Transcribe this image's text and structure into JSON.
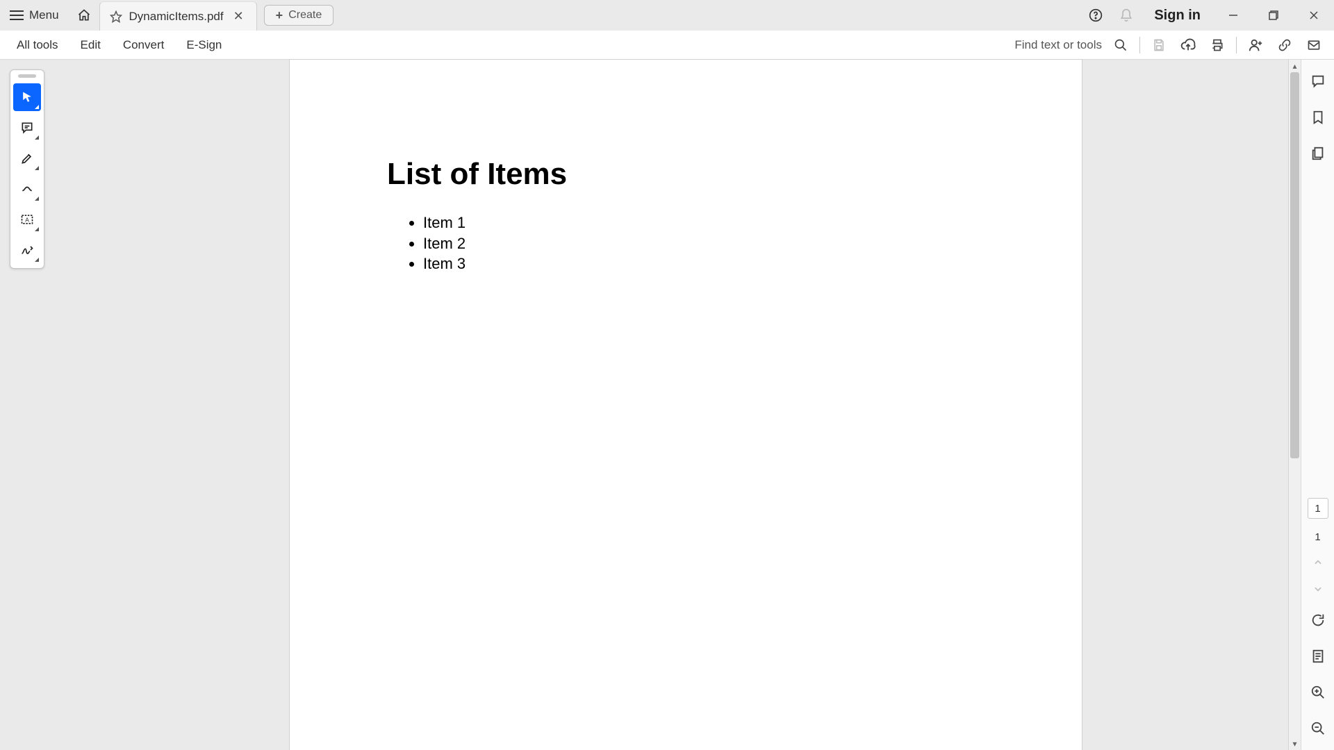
{
  "titlebar": {
    "menu_label": "Menu",
    "tab_title": "DynamicItems.pdf",
    "create_label": "Create",
    "signin_label": "Sign in"
  },
  "toolbar": {
    "all_tools": "All tools",
    "edit": "Edit",
    "convert": "Convert",
    "esign": "E-Sign",
    "find_label": "Find text or tools"
  },
  "document": {
    "heading": "List of Items",
    "items": [
      "Item 1",
      "Item 2",
      "Item 3"
    ]
  },
  "pager": {
    "current": "1",
    "total": "1"
  }
}
